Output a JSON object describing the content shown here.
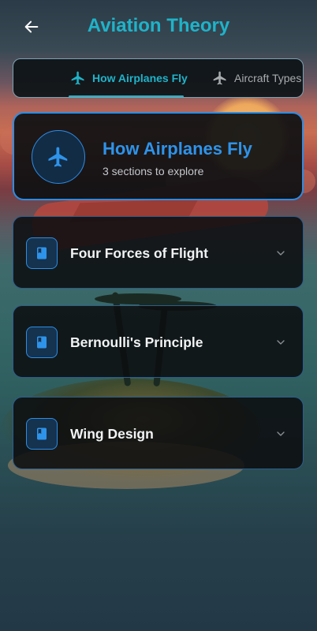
{
  "app_bar": {
    "title": "Aviation Theory",
    "back_icon": "arrow-left-icon"
  },
  "tabs": [
    {
      "label": "How Airplanes Fly",
      "icon": "airplane-icon",
      "active": true
    },
    {
      "label": "Aircraft Types",
      "icon": "airplane-icon",
      "active": false
    }
  ],
  "hero": {
    "title": "How Airplanes Fly",
    "subtitle": "3 sections to explore",
    "icon": "airplane-icon"
  },
  "sections": [
    {
      "title": "Four Forces of Flight",
      "icon": "book-icon",
      "expanded": false
    },
    {
      "title": "Bernoulli's Principle",
      "icon": "book-icon",
      "expanded": false
    },
    {
      "title": "Wing Design",
      "icon": "book-icon",
      "expanded": false
    }
  ],
  "colors": {
    "accent_cyan": "#1fb3c9",
    "accent_blue": "#2e93ea",
    "card_bg": "#0e1012",
    "inactive_text": "#a8acae"
  }
}
